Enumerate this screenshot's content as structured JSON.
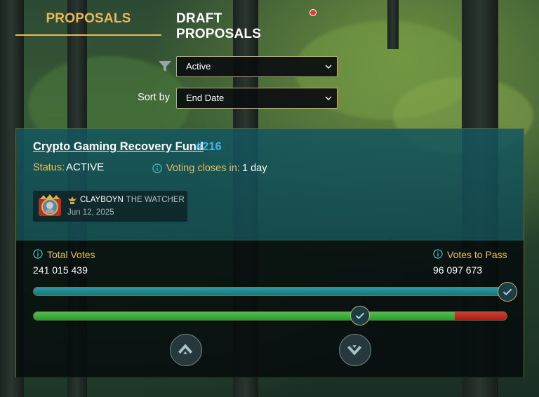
{
  "tabs": {
    "proposals": "PROPOSALS",
    "drafts": "DRAFT PROPOSALS"
  },
  "filters": {
    "status_value": "Active",
    "sort_label": "Sort by",
    "sort_value": "End Date"
  },
  "proposal": {
    "title": "Crypto Gaming Recovery Fund",
    "number": "#216",
    "status_key": "Status:",
    "status_value": "ACTIVE",
    "closes_key": "Voting closes in:",
    "closes_value": "1 day",
    "author": {
      "name": "CLAYBOYN",
      "title": "THE WATCHER",
      "date": "Jun 12, 2025"
    },
    "total_votes_label": "Total Votes",
    "total_votes_value": "241 015 439",
    "votes_to_pass_label": "Votes to Pass",
    "votes_to_pass_value": "96 097 673",
    "total_progress": 1.0,
    "approval_fraction": 0.89,
    "pass_threshold": 0.69
  },
  "colors": {
    "accent_gold": "#e9b85a",
    "link_blue": "#3fb3e8",
    "yes_green": "#3faf3d",
    "no_red": "#c12d24",
    "teal": "#1f8a94",
    "notification": "#e23b3b"
  },
  "icons": {
    "filter": "funnel-icon",
    "info": "info-icon",
    "check": "check-icon",
    "upvote": "chevron-up-icon",
    "downvote": "chevron-down-icon",
    "rank": "rank-icon"
  }
}
